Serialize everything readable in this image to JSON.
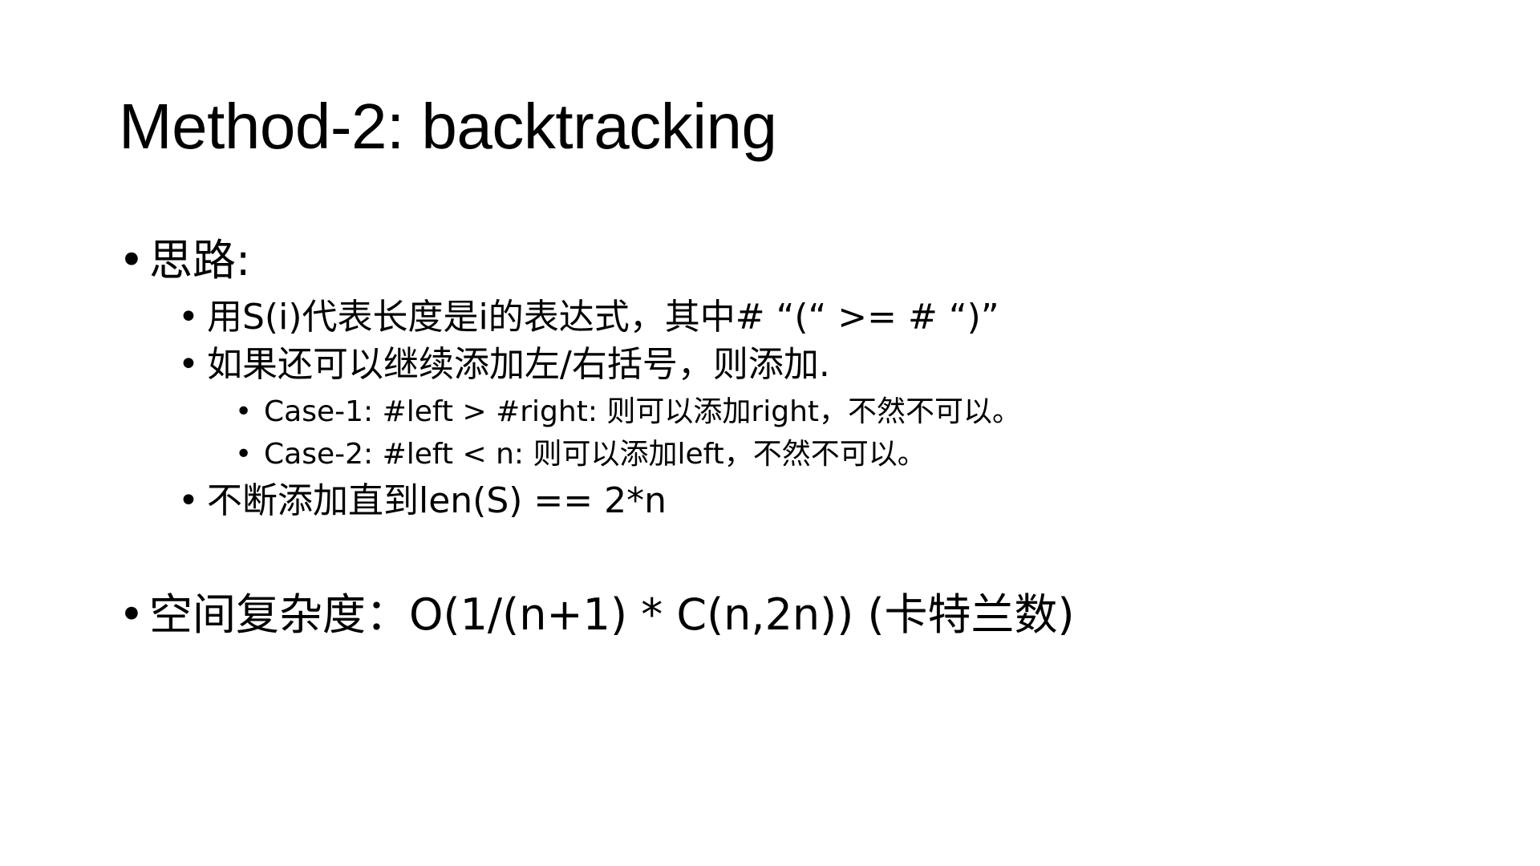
{
  "slide": {
    "title": "Method-2: backtracking",
    "bullet_char": "•",
    "items": [
      {
        "text": "思路:",
        "children": [
          {
            "text": "用S(i)代表长度是i的表达式，其中# “(“ >= # “)”"
          },
          {
            "text": "如果还可以继续添加左/右括号，则添加.",
            "children": [
              {
                "text": "Case-1: #left > #right: 则可以添加right，不然不可以。"
              },
              {
                "text": "Case-2: #left < n: 则可以添加left，不然不可以。"
              }
            ]
          },
          {
            "text": "不断添加直到len(S) == 2*n"
          }
        ]
      },
      {
        "text": "空间复杂度：O(1/(n+1) * C(n,2n))  (卡特兰数)"
      }
    ]
  }
}
